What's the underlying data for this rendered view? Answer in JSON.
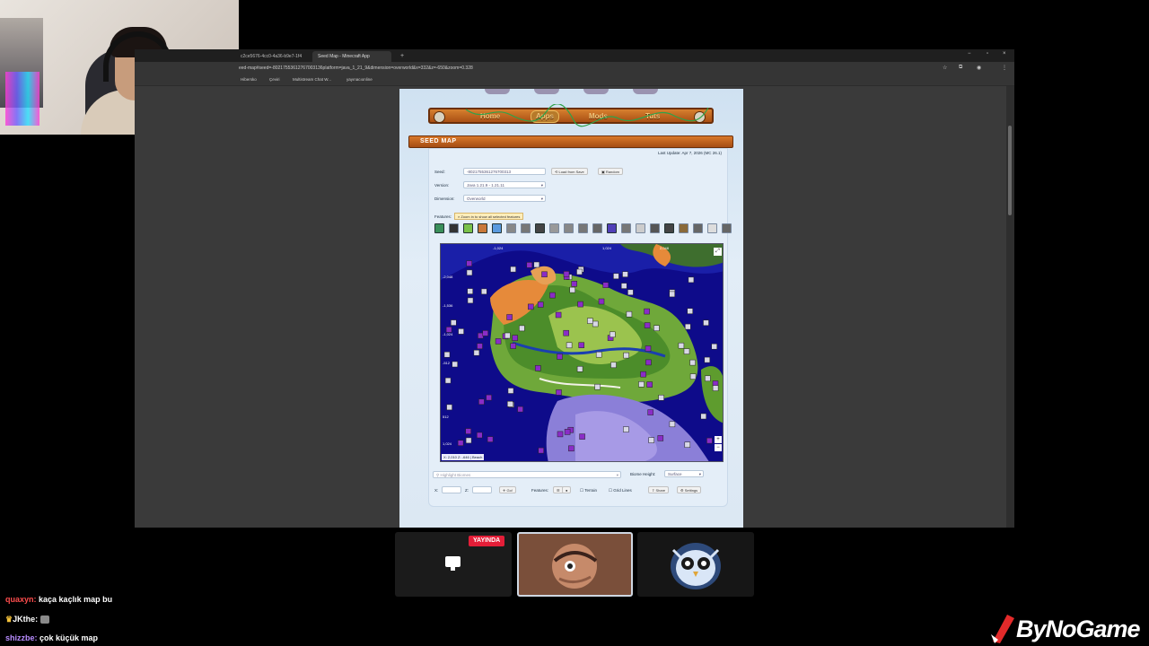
{
  "browser": {
    "tabs": [
      {
        "label": "c2ce5676-4cc0-4a36-b9e7-1f4"
      },
      {
        "label": "Seed Map - Minecraft App"
      }
    ],
    "url": "eed-map#seed=-80217553612767003136platform=java_1_21_9&dimension=overworld&x=332&z=-650&zoom=0.328",
    "bookmarks": [
      {
        "label": "Hibersko"
      },
      {
        "label": "Çeviri"
      },
      {
        "label": "Multistream Chat W..."
      },
      {
        "label": "yayınacıonline"
      }
    ]
  },
  "site": {
    "nav": [
      {
        "label": "Home"
      },
      {
        "label": "Apps"
      },
      {
        "label": "Mods"
      },
      {
        "label": "Tuts"
      }
    ],
    "section_title": "SEED MAP",
    "last_update": "Last Update: Apr 7, 2026 (MC 26.1)",
    "seed_label": "Seed:",
    "seed_value": "-8021755361276700313",
    "load_from_save": "Load from Save",
    "random": "Random",
    "version_label": "Version:",
    "version_value": "Java 1.21.9 - 1.21.11",
    "dimension_label": "Dimension:",
    "dimension_value": "Overworld",
    "features_label": "Features:",
    "tooltip": "Zoom in to show all selected features",
    "map_coords_top": [
      "-1,024",
      "1,024",
      "2,048"
    ],
    "map_coords_left": [
      "-2,048",
      "-1,536",
      "-1,024",
      "-512",
      "512",
      "1,024"
    ],
    "map_status": "X: 2,010 Z: -646 | Beach",
    "highlight_biomes": "Highlight Biomes",
    "biome_height_label": "Biome Height:",
    "biome_height_value": "Surface",
    "x_label": "X:",
    "z_label": "Z:",
    "go": "Go!",
    "features2_label": "Features:",
    "terrain": "Terrain",
    "grid_lines": "Grid Lines",
    "share": "Share",
    "settings": "Settings"
  },
  "stream": {
    "live_badge": "YAYINDA",
    "chat": [
      {
        "user": "quaxyn:",
        "message": "kaça kaçlık map bu",
        "color": "#ff4d4d"
      },
      {
        "user": "JKthe:",
        "message": "",
        "color": "#ffffff"
      },
      {
        "user": "shizzbe:",
        "message": "çok küçük map",
        "color": "#b88cff"
      }
    ],
    "logo": "ByNoGame"
  },
  "colors": {
    "ocean": "#0e0b8a",
    "accent_orange": "#c3631e",
    "live_red": "#e41e38"
  }
}
